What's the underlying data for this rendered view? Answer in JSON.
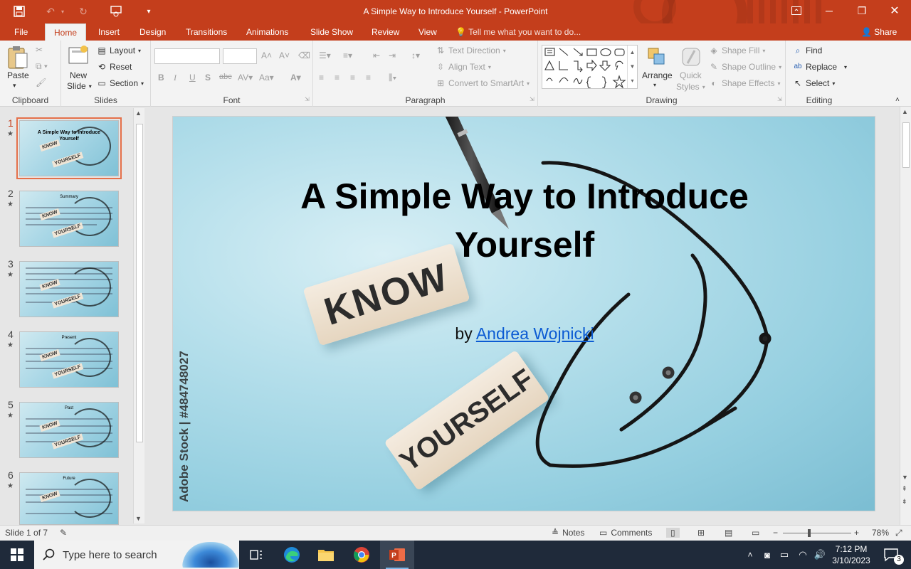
{
  "window": {
    "title": "A Simple Way to Introduce Yourself - PowerPoint"
  },
  "ribbon": {
    "tabs": [
      "File",
      "Home",
      "Insert",
      "Design",
      "Transitions",
      "Animations",
      "Slide Show",
      "Review",
      "View"
    ],
    "active_tab": "Home",
    "tell_me": "Tell me what you want to do...",
    "share": "Share",
    "groups": {
      "clipboard": {
        "label": "Clipboard",
        "paste": "Paste"
      },
      "slides": {
        "label": "Slides",
        "new_slide_1": "New",
        "new_slide_2": "Slide",
        "layout": "Layout",
        "reset": "Reset",
        "section": "Section"
      },
      "font": {
        "label": "Font"
      },
      "paragraph": {
        "label": "Paragraph",
        "text_direction": "Text Direction",
        "align_text": "Align Text",
        "convert_smartart": "Convert to SmartArt"
      },
      "drawing": {
        "label": "Drawing",
        "arrange": "Arrange",
        "quick_styles_1": "Quick",
        "quick_styles_2": "Styles",
        "shape_fill": "Shape Fill",
        "shape_outline": "Shape Outline",
        "shape_effects": "Shape Effects"
      },
      "editing": {
        "label": "Editing",
        "find": "Find",
        "replace": "Replace",
        "select": "Select"
      }
    }
  },
  "thumbnails": [
    {
      "number": "1",
      "title": "A Simple Way to Introduce Yourself",
      "selected": true
    },
    {
      "number": "2",
      "title": "Summary"
    },
    {
      "number": "3",
      "title": ""
    },
    {
      "number": "4",
      "title": "Present"
    },
    {
      "number": "5",
      "title": "Past"
    },
    {
      "number": "6",
      "title": "Future"
    }
  ],
  "slide": {
    "title": "A Simple Way to Introduce Yourself",
    "byline_prefix": "by",
    "author": "Andrea Wojnicki",
    "block_know": "KNOW",
    "block_yourself": "YOURSELF",
    "watermark": "Adobe Stock | #484748027"
  },
  "status": {
    "slide_counter": "Slide 1 of 7",
    "notes": "Notes",
    "comments": "Comments",
    "zoom": "78%"
  },
  "taskbar": {
    "search_placeholder": "Type here to search",
    "time": "7:12 PM",
    "date": "3/10/2023",
    "notification_count": "3"
  },
  "colors": {
    "accent": "#c43e1c",
    "hyperlink": "#0b5bd3",
    "taskbar": "#1f2a3a"
  }
}
